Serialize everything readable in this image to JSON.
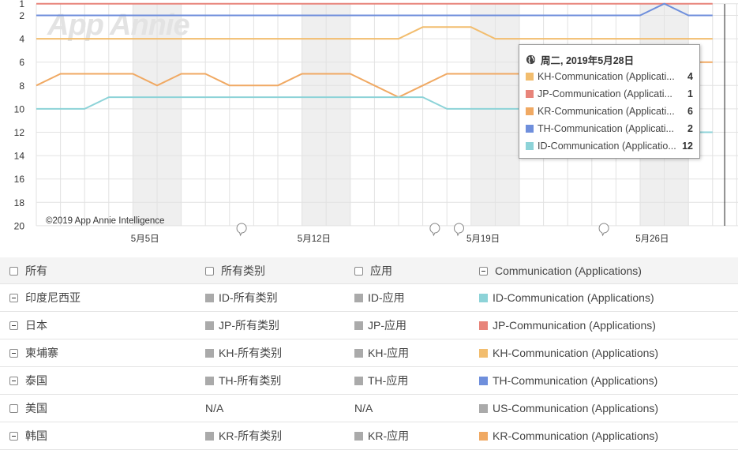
{
  "chart_data": {
    "type": "line",
    "y_axis": {
      "reversed": true,
      "min": 1,
      "max": 20,
      "ticks": [
        1,
        2,
        4,
        6,
        8,
        10,
        12,
        14,
        16,
        18,
        20
      ]
    },
    "x_axis": {
      "start_date": "2019-05-01",
      "ticks": [
        {
          "date": "2019-05-05",
          "label": "5月5日"
        },
        {
          "date": "2019-05-12",
          "label": "5月12日"
        },
        {
          "date": "2019-05-19",
          "label": "5月19日"
        },
        {
          "date": "2019-05-26",
          "label": "5月26日"
        }
      ]
    },
    "weekend_bands": [
      [
        "2019-05-05",
        "2019-05-06"
      ],
      [
        "2019-05-12",
        "2019-05-13"
      ],
      [
        "2019-05-19",
        "2019-05-20"
      ],
      [
        "2019-05-26",
        "2019-05-27"
      ]
    ],
    "cursor_date": "2019-05-29",
    "series": [
      {
        "name": "JP-Communication (Applications)",
        "color": "#e8847a",
        "values": [
          1,
          1,
          1,
          1,
          1,
          1,
          1,
          1,
          1,
          1,
          1,
          1,
          1,
          1,
          1,
          1,
          1,
          1,
          1,
          1,
          1,
          1,
          1,
          1,
          1,
          1,
          1,
          1,
          1
        ]
      },
      {
        "name": "TH-Communication (Applications)",
        "color": "#6f8fdc",
        "values": [
          2,
          2,
          2,
          2,
          2,
          2,
          2,
          2,
          2,
          2,
          2,
          2,
          2,
          2,
          2,
          2,
          2,
          2,
          2,
          2,
          2,
          2,
          2,
          2,
          2,
          2,
          1,
          2,
          2
        ]
      },
      {
        "name": "KH-Communication (Applications)",
        "color": "#f2bd6e",
        "values": [
          4,
          4,
          4,
          4,
          4,
          4,
          4,
          4,
          4,
          4,
          4,
          4,
          4,
          4,
          4,
          4,
          3,
          3,
          3,
          4,
          4,
          4,
          4,
          4,
          4,
          4,
          4,
          4,
          4
        ]
      },
      {
        "name": "KR-Communication (Applications)",
        "color": "#f0a963",
        "values": [
          8,
          7,
          7,
          7,
          7,
          8,
          7,
          7,
          8,
          8,
          8,
          7,
          7,
          7,
          8,
          9,
          8,
          7,
          7,
          7,
          7,
          7,
          7,
          7,
          7,
          7,
          7,
          6,
          6
        ]
      },
      {
        "name": "ID-Communication (Applications)",
        "color": "#8dd3d8",
        "values": [
          10,
          10,
          10,
          9,
          9,
          9,
          9,
          9,
          9,
          9,
          9,
          9,
          9,
          9,
          9,
          9,
          9,
          10,
          10,
          10,
          10,
          10,
          10,
          10,
          10,
          10,
          10,
          12,
          12
        ]
      }
    ],
    "annotation_markers": [
      "2019-05-09",
      "2019-05-17",
      "2019-05-18",
      "2019-05-24"
    ]
  },
  "watermark": "App Annie",
  "copyright": "©2019 App Annie Intelligence",
  "tooltip": {
    "date": "周二, 2019年5月28日",
    "rows": [
      {
        "name": "KH-Communication (Applications)",
        "display": "KH-Communication (Applicati...",
        "value": "4",
        "color": "#f2bd6e"
      },
      {
        "name": "JP-Communication (Applications)",
        "display": "JP-Communication (Applicati...",
        "value": "1",
        "color": "#e8847a"
      },
      {
        "name": "KR-Communication (Applications)",
        "display": "KR-Communication (Applicati...",
        "value": "6",
        "color": "#f0a963"
      },
      {
        "name": "TH-Communication (Applications)",
        "display": "TH-Communication (Applicati...",
        "value": "2",
        "color": "#6f8fdc"
      },
      {
        "name": "ID-Communication (Applications)",
        "display": "ID-Communication (Applicatio...",
        "value": "12",
        "color": "#8dd3d8"
      }
    ]
  },
  "table": {
    "header": {
      "all": "所有",
      "all_categories": "所有类别",
      "apps": "应用",
      "communication": "Communication (Applications)"
    },
    "rows": [
      {
        "country": "印度尼西亚",
        "checked": true,
        "category": "ID-所有类别",
        "app": "ID-应用",
        "comm": "ID-Communication (Applications)",
        "color": "#8dd3d8"
      },
      {
        "country": "日本",
        "checked": true,
        "category": "JP-所有类别",
        "app": "JP-应用",
        "comm": "JP-Communication (Applications)",
        "color": "#e8847a"
      },
      {
        "country": "柬埔寨",
        "checked": true,
        "category": "KH-所有类别",
        "app": "KH-应用",
        "comm": "KH-Communication (Applications)",
        "color": "#f2bd6e"
      },
      {
        "country": "泰国",
        "checked": true,
        "category": "TH-所有类别",
        "app": "TH-应用",
        "comm": "TH-Communication (Applications)",
        "color": "#6f8fdc"
      },
      {
        "country": "美国",
        "checked": false,
        "category": "N/A",
        "app": "N/A",
        "comm": "US-Communication (Applications)",
        "color": "#aaaaaa"
      },
      {
        "country": "韩国",
        "checked": true,
        "category": "KR-所有类别",
        "app": "KR-应用",
        "comm": "KR-Communication (Applications)",
        "color": "#f0a963"
      }
    ]
  }
}
